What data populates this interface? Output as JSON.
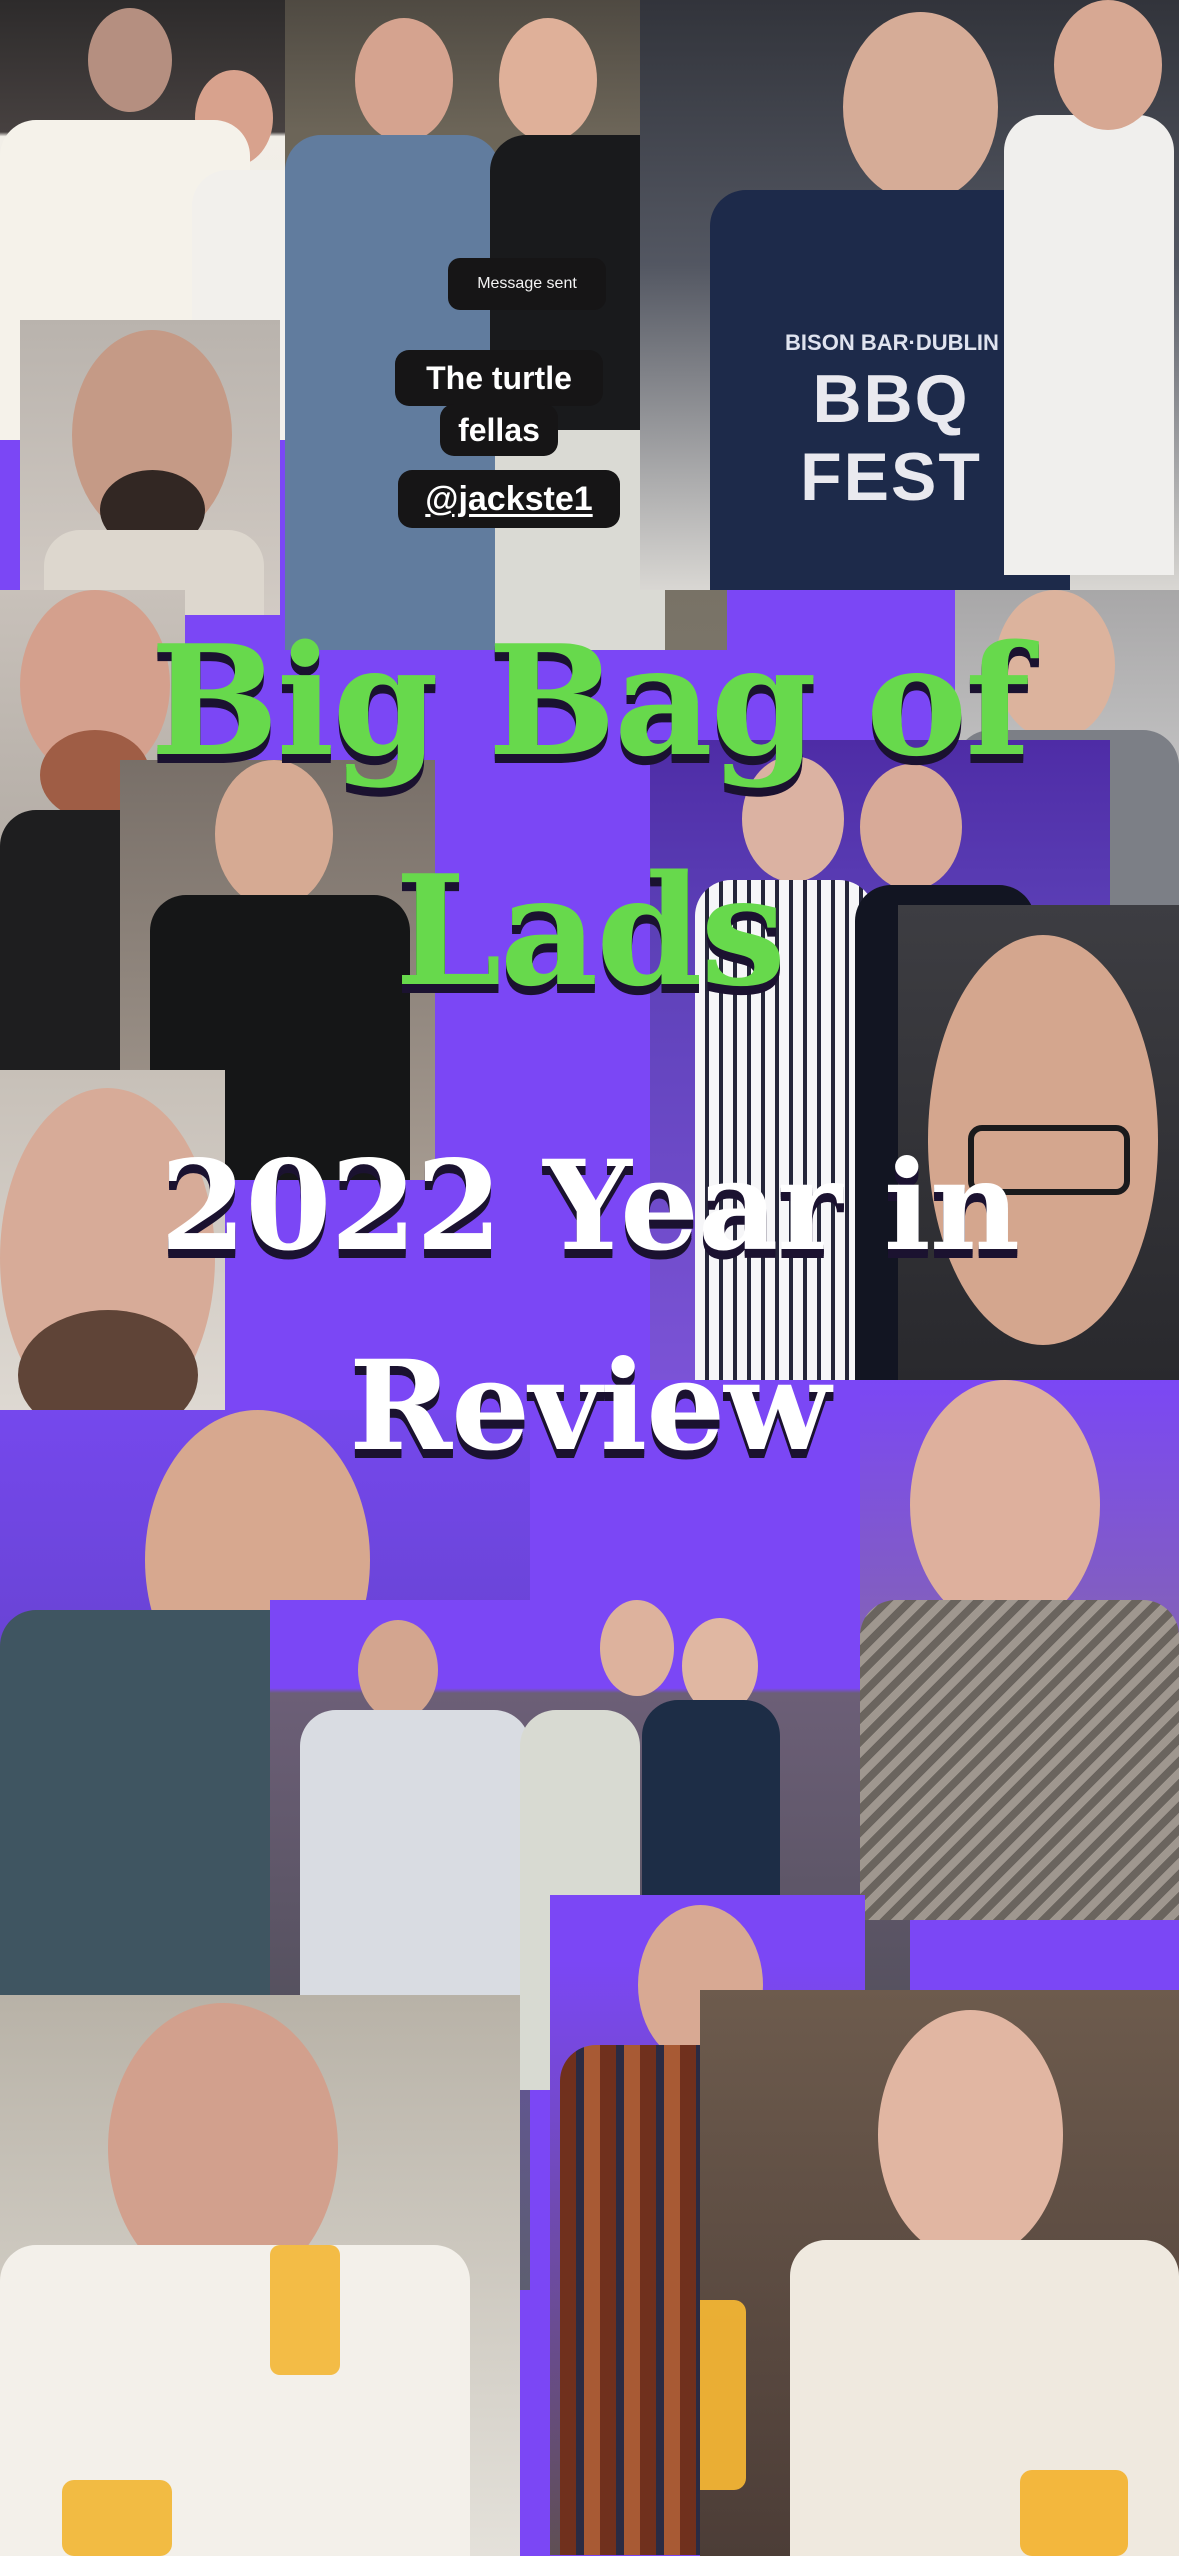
{
  "story": {
    "message_sent": "Message sent",
    "caption_line_1": "The turtle",
    "caption_line_2": "fellas",
    "mention": "@jackste1",
    "title_line_1": "Big Bag of",
    "title_line_2": "Lads",
    "subtitle_line_1": "2022 Year in",
    "subtitle_line_2": "Review",
    "shirt_text": "BBQ FEST",
    "shirt_subtext": "BISON BAR·DUBLIN"
  },
  "colors": {
    "background": "#7b47f5",
    "title_green": "#67d94c",
    "sticker_bg": "#161516",
    "text_white": "#ffffff"
  }
}
